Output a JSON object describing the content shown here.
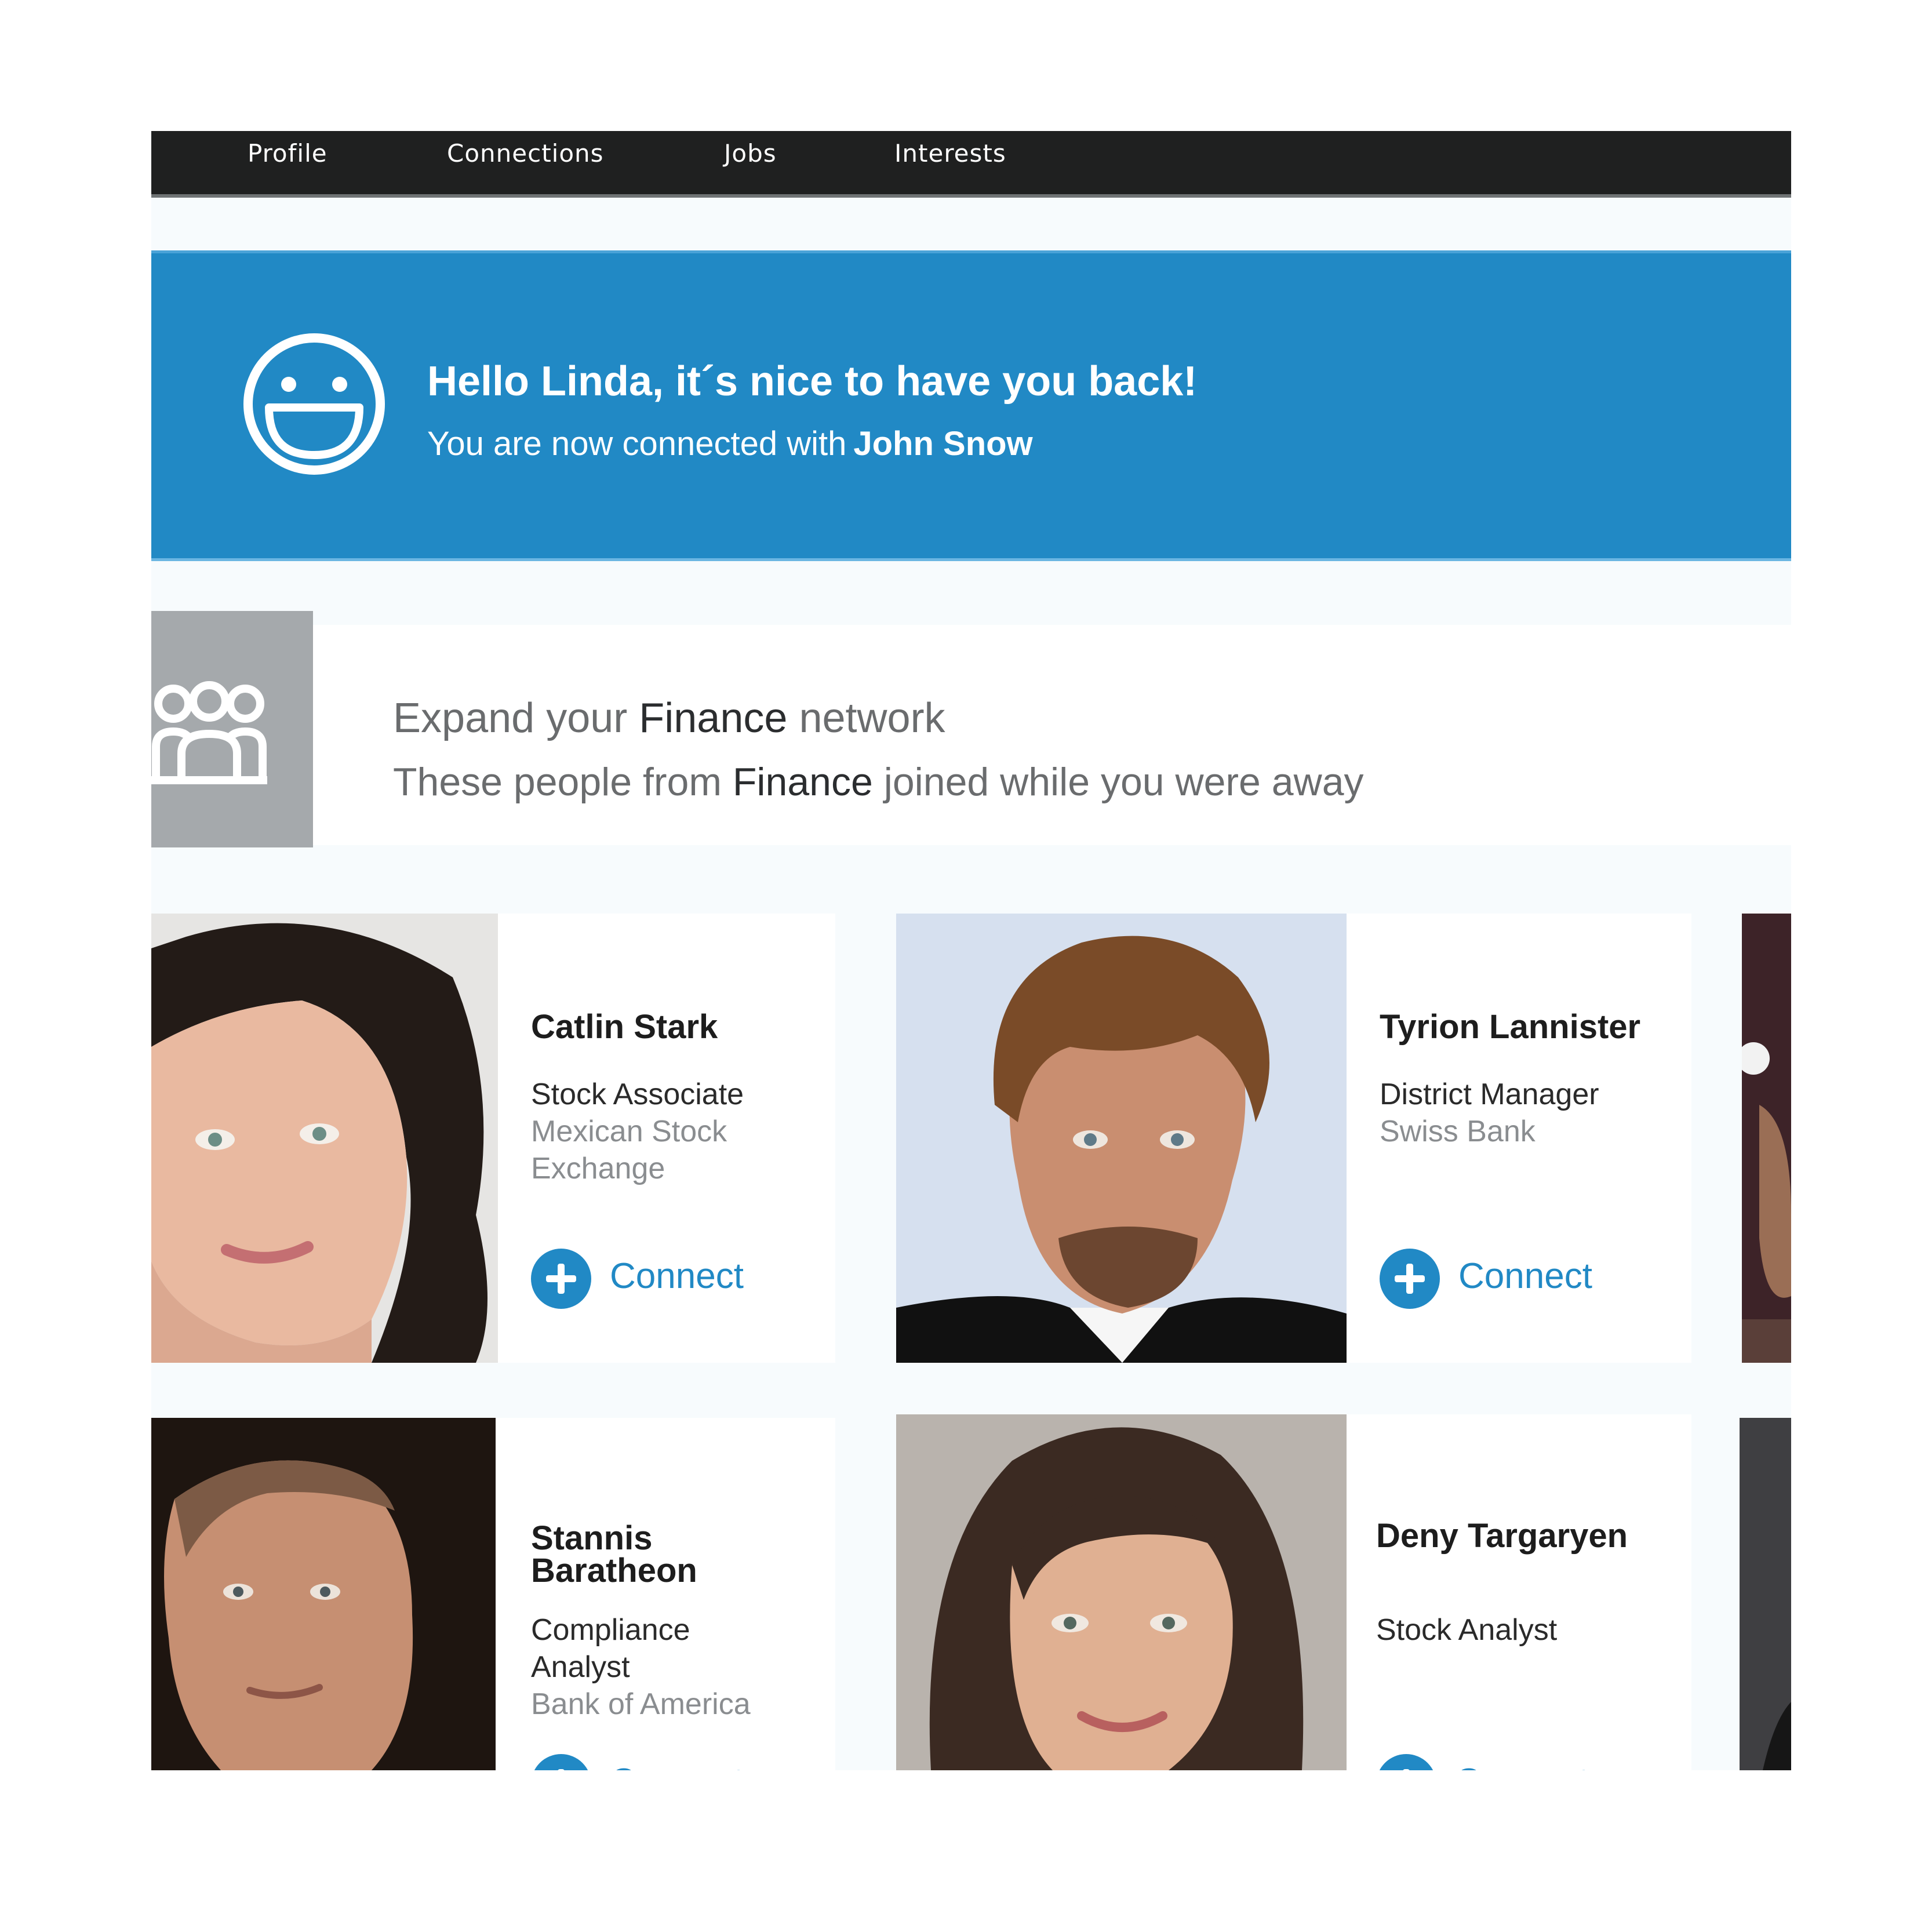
{
  "nav": {
    "items": [
      {
        "label": "Profile"
      },
      {
        "label": "Connections"
      },
      {
        "label": "Jobs"
      },
      {
        "label": "Interests"
      }
    ]
  },
  "banner": {
    "greeting": "Hello Linda, it´s nice to have you back!",
    "connected_prefix": "You are now connected with",
    "connected_name": "John Snow",
    "icon": "smiley-icon"
  },
  "expand": {
    "title_prefix": "Expand your",
    "title_industry": "Finance",
    "title_suffix": "network",
    "sub_prefix": "These people from",
    "sub_industry": "Finance",
    "sub_suffix": "joined while you were away",
    "icon": "group-icon"
  },
  "people": [
    {
      "name": "Catlin Stark",
      "title": "Stock Associate",
      "company": "Mexican Stock Exchange",
      "connect_label": "Connect"
    },
    {
      "name": "Tyrion Lannister",
      "title": "District Manager",
      "company": "Swiss Bank",
      "connect_label": "Connect"
    },
    {
      "name": "Stannis Baratheon",
      "title": "Compliance Analyst",
      "company": "Bank of America",
      "connect_label": "Connect"
    },
    {
      "name": "Deny Targaryen",
      "title": "Stock Analyst",
      "company": "",
      "connect_label": "Connect"
    }
  ],
  "colors": {
    "accent": "#2189c5",
    "nav_bg": "#1f2020",
    "icon_box": "#a5a9ac"
  }
}
